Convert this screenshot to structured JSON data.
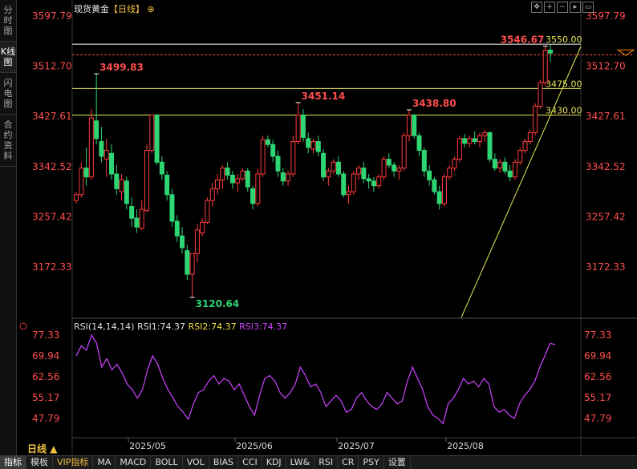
{
  "side_tabs": [
    "分时图",
    "K线图",
    "闪电图",
    "合约资料"
  ],
  "active_side_tab": 1,
  "header": {
    "instrument": "现货黄金",
    "period": "【日线】",
    "add_icon": "⊕"
  },
  "toolbar_icons": [
    "move-icon",
    "zoom-in-icon",
    "zoom-out-icon",
    "refresh-icon",
    "expand-icon"
  ],
  "colors": {
    "up": "#ff3b3b",
    "down": "#2ed573",
    "level": "#e8e85a",
    "rsi": "#cc44ff",
    "axis_text": "#ff4d4d"
  },
  "price_axis_labels": [
    "3597.79",
    "3512.70",
    "3427.61",
    "3342.52",
    "3257.42",
    "3172.33"
  ],
  "rsi_axis_labels": [
    "77.33",
    "69.94",
    "62.56",
    "55.17",
    "47.79"
  ],
  "date_labels": [
    "2025/05",
    "2025/06",
    "2025/07",
    "2025/08"
  ],
  "annotations": [
    "3499.83",
    "3451.14",
    "3438.80",
    "3120.64",
    "3546.67"
  ],
  "levels": [
    "3550.00",
    "3475.00",
    "3430.00"
  ],
  "rsi_header": {
    "title": "RSI(14,14,14)",
    "rsi1": "RSI1:74.37",
    "rsi2": "RSI2:74.37",
    "rsi3": "RSI3:74.37"
  },
  "period_label": "日线",
  "bottom_tabs": [
    "指标",
    "模板",
    "VIP指标",
    "MA",
    "MACD",
    "BOLL",
    "VOL",
    "BIAS",
    "CCI",
    "KDJ",
    "LW&",
    "RSI",
    "CR",
    "PSY",
    "设置"
  ],
  "active_bottom_tab": 0,
  "chart_data": {
    "type": "candlestick",
    "title": "现货黄金",
    "period": "日线",
    "price_range": [
      3100,
      3600
    ],
    "levels": [
      3550.0,
      3475.0,
      3430.0
    ],
    "candles": [
      [
        3285,
        3300,
        3280,
        3295
      ],
      [
        3295,
        3350,
        3290,
        3340
      ],
      [
        3340,
        3375,
        3310,
        3325
      ],
      [
        3325,
        3440,
        3320,
        3425
      ],
      [
        3420,
        3499.83,
        3380,
        3390
      ],
      [
        3385,
        3410,
        3350,
        3360
      ],
      [
        3355,
        3390,
        3325,
        3370
      ],
      [
        3365,
        3380,
        3320,
        3330
      ],
      [
        3330,
        3345,
        3295,
        3305
      ],
      [
        3300,
        3330,
        3285,
        3320
      ],
      [
        3318,
        3325,
        3270,
        3280
      ],
      [
        3275,
        3290,
        3240,
        3255
      ],
      [
        3255,
        3270,
        3230,
        3240
      ],
      [
        3238,
        3285,
        3235,
        3270
      ],
      [
        3268,
        3380,
        3265,
        3370
      ],
      [
        3370,
        3432,
        3365,
        3430
      ],
      [
        3430,
        3432,
        3345,
        3350
      ],
      [
        3350,
        3360,
        3320,
        3330
      ],
      [
        3328,
        3335,
        3285,
        3295
      ],
      [
        3295,
        3305,
        3240,
        3250
      ],
      [
        3250,
        3260,
        3215,
        3225
      ],
      [
        3225,
        3240,
        3195,
        3205
      ],
      [
        3200,
        3210,
        3150,
        3160
      ],
      [
        3160,
        3175,
        3120.64,
        3195
      ],
      [
        3195,
        3245,
        3180,
        3235
      ],
      [
        3230,
        3255,
        3225,
        3248
      ],
      [
        3248,
        3290,
        3245,
        3285
      ],
      [
        3285,
        3315,
        3275,
        3305
      ],
      [
        3305,
        3330,
        3295,
        3320
      ],
      [
        3320,
        3345,
        3305,
        3340
      ],
      [
        3340,
        3350,
        3320,
        3328
      ],
      [
        3328,
        3335,
        3305,
        3315
      ],
      [
        3315,
        3330,
        3300,
        3322
      ],
      [
        3322,
        3340,
        3318,
        3335
      ],
      [
        3335,
        3340,
        3300,
        3308
      ],
      [
        3305,
        3310,
        3270,
        3280
      ],
      [
        3280,
        3340,
        3275,
        3330
      ],
      [
        3330,
        3395,
        3325,
        3388
      ],
      [
        3388,
        3395,
        3375,
        3380
      ],
      [
        3380,
        3388,
        3350,
        3360
      ],
      [
        3360,
        3370,
        3325,
        3335
      ],
      [
        3332,
        3340,
        3310,
        3318
      ],
      [
        3318,
        3335,
        3310,
        3330
      ],
      [
        3330,
        3395,
        3325,
        3385
      ],
      [
        3385,
        3451.14,
        3380,
        3430
      ],
      [
        3430,
        3440,
        3385,
        3392
      ],
      [
        3390,
        3400,
        3365,
        3375
      ],
      [
        3372,
        3390,
        3365,
        3385
      ],
      [
        3385,
        3395,
        3360,
        3368
      ],
      [
        3365,
        3372,
        3318,
        3325
      ],
      [
        3325,
        3340,
        3310,
        3335
      ],
      [
        3335,
        3355,
        3330,
        3350
      ],
      [
        3350,
        3360,
        3325,
        3330
      ],
      [
        3330,
        3335,
        3290,
        3295
      ],
      [
        3295,
        3310,
        3280,
        3300
      ],
      [
        3300,
        3335,
        3295,
        3330
      ],
      [
        3330,
        3345,
        3320,
        3340
      ],
      [
        3340,
        3350,
        3315,
        3322
      ],
      [
        3322,
        3330,
        3305,
        3318
      ],
      [
        3318,
        3325,
        3300,
        3310
      ],
      [
        3310,
        3330,
        3305,
        3325
      ],
      [
        3325,
        3360,
        3320,
        3355
      ],
      [
        3355,
        3365,
        3340,
        3345
      ],
      [
        3345,
        3350,
        3325,
        3335
      ],
      [
        3335,
        3345,
        3320,
        3340
      ],
      [
        3340,
        3400,
        3335,
        3395
      ],
      [
        3395,
        3438.8,
        3385,
        3430
      ],
      [
        3430,
        3432,
        3390,
        3395
      ],
      [
        3395,
        3400,
        3360,
        3370
      ],
      [
        3370,
        3375,
        3325,
        3335
      ],
      [
        3335,
        3345,
        3310,
        3320
      ],
      [
        3320,
        3325,
        3295,
        3300
      ],
      [
        3300,
        3310,
        3270,
        3280
      ],
      [
        3280,
        3330,
        3275,
        3325
      ],
      [
        3325,
        3345,
        3320,
        3340
      ],
      [
        3340,
        3360,
        3335,
        3355
      ],
      [
        3355,
        3395,
        3350,
        3390
      ],
      [
        3390,
        3398,
        3375,
        3382
      ],
      [
        3382,
        3395,
        3375,
        3390
      ],
      [
        3390,
        3402,
        3380,
        3385
      ],
      [
        3385,
        3400,
        3375,
        3395
      ],
      [
        3395,
        3405,
        3385,
        3400
      ],
      [
        3400,
        3402,
        3350,
        3355
      ],
      [
        3355,
        3365,
        3335,
        3340
      ],
      [
        3340,
        3355,
        3332,
        3350
      ],
      [
        3350,
        3358,
        3330,
        3335
      ],
      [
        3335,
        3345,
        3318,
        3325
      ],
      [
        3325,
        3355,
        3320,
        3350
      ],
      [
        3350,
        3375,
        3345,
        3370
      ],
      [
        3370,
        3390,
        3365,
        3385
      ],
      [
        3385,
        3405,
        3380,
        3400
      ],
      [
        3400,
        3450,
        3395,
        3445
      ],
      [
        3445,
        3490,
        3440,
        3485
      ],
      [
        3485,
        3546.67,
        3480,
        3540
      ],
      [
        3540,
        3550,
        3520,
        3535
      ]
    ],
    "rsi": {
      "name": "RSI(14,14,14)",
      "range": [
        45,
        80
      ],
      "last": 74.37,
      "values": [
        70,
        73.5,
        72,
        77.33,
        74.5,
        66,
        69,
        65,
        67,
        64,
        60,
        58,
        55,
        58,
        65,
        70,
        67,
        62,
        58,
        55,
        52,
        50,
        47.5,
        53,
        57,
        58,
        61,
        63,
        60,
        62,
        61,
        58,
        60,
        56,
        52,
        49,
        56,
        62,
        63,
        61,
        57,
        55,
        57,
        60,
        66,
        63,
        59,
        60,
        57,
        52,
        54,
        56,
        54,
        50,
        51,
        55,
        57,
        54,
        52,
        51,
        53,
        57,
        55,
        53,
        54,
        61,
        66,
        62,
        58,
        52,
        49,
        47.79,
        46,
        53,
        55,
        58,
        62,
        60,
        61,
        59,
        62,
        60,
        52,
        50,
        51,
        49,
        47.79,
        53,
        56,
        58,
        61,
        66,
        70,
        74.37,
        74
      ]
    }
  }
}
